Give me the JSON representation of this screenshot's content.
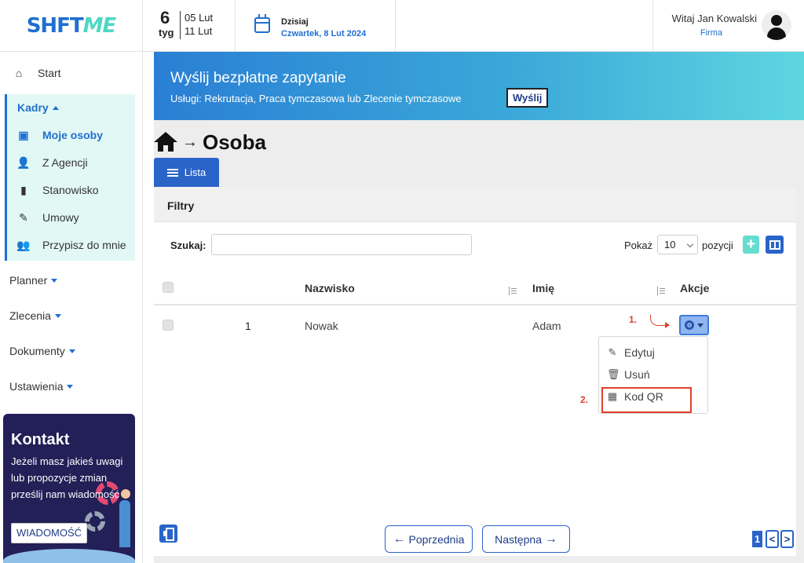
{
  "header": {
    "logo_part1": "SHFT",
    "logo_part2": "ME",
    "week_number": "6",
    "week_label": "tyg",
    "week_start": "05 Lut",
    "week_end": "11 Lut",
    "today_label": "Dzisiaj",
    "today_date": "Czwartek, 8 Lut 2024",
    "greeting": "Witaj Jan Kowalski",
    "company": "Firma"
  },
  "sidebar": {
    "start": "Start",
    "kadry": "Kadry",
    "kadry_items": [
      {
        "label": "Moje osoby",
        "icon": "id-card-icon"
      },
      {
        "label": "Z Agencji",
        "icon": "user-check-icon"
      },
      {
        "label": "Stanowisko",
        "icon": "book-icon"
      },
      {
        "label": "Umowy",
        "icon": "contract-sign-icon"
      },
      {
        "label": "Przypisz do mnie",
        "icon": "users-icon"
      }
    ],
    "planner": "Planner",
    "zlecenia": "Zlecenia",
    "dokumenty": "Dokumenty",
    "ustawienia": "Ustawienia",
    "contact": {
      "title": "Kontakt",
      "text": "Jeżeli masz jakieś uwagi lub propozycje zmian prześlij nam wiadomość",
      "button": "WIADOMOŚĆ"
    }
  },
  "banner": {
    "title": "Wyślij bezpłatne zapytanie",
    "subtitle": "Usługi: Rekrutacja, Praca tymczasowa lub Zlecenie tymczasowe",
    "button": "Wyślij"
  },
  "page": {
    "title": "Osoba",
    "tab_list": "Lista",
    "filters": "Filtry",
    "search_label": "Szukaj:",
    "search_value": "",
    "show_label": "Pokaż",
    "show_value": "10",
    "entries_label": "pozycji",
    "add_symbol": "+"
  },
  "table": {
    "columns": [
      "Nazwisko",
      "Imię",
      "Akcje"
    ],
    "rows": [
      {
        "no": "1",
        "surname": "Nowak",
        "name": "Adam"
      }
    ]
  },
  "annotations": {
    "step1": "1.",
    "step2": "2."
  },
  "actions_menu": {
    "edit": "Edytuj",
    "delete": "Usuń",
    "qr": "Kod QR"
  },
  "pagination": {
    "prev": "Poprzednia",
    "next": "Następna",
    "current_page": "1",
    "prev_symbol": "<",
    "next_symbol": ">"
  },
  "colors": {
    "primary": "#2a64c9",
    "accent": "#4fd7c4",
    "annotation": "#e0402a",
    "sidebar_active_bg": "#e2f8f4"
  }
}
